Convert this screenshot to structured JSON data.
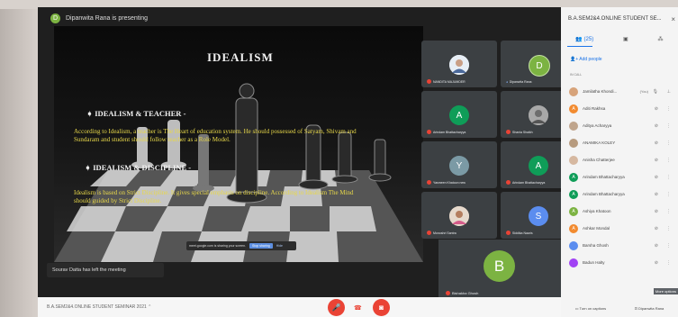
{
  "presenter_bar": {
    "initial": "D",
    "text": "Dipanwita Rana is presenting"
  },
  "slide": {
    "title": "IDEALISM",
    "heading1": "IDEALISM & TEACHER -",
    "paragraph1": "According to Idealism, a teacher is The Heart of education system. He should possessed of Satyam, Shivam and Sundaram and student should follow teacher as a Role Model.",
    "heading2": "IDEALISM & DISCIPLINE -",
    "paragraph2": "Idealism is based on Strict Discipline. It gives special emphasis on discipline. According to Idealism The Mind should guided by Strict Discipline."
  },
  "share_bar": {
    "text": "meet.google.com is sharing your screen.",
    "stop_label": "Stop sharing",
    "hide_label": "Hide"
  },
  "notification": "Sourav Datta has left the meeting",
  "tiles": [
    {
      "name": "NANDITA MAJUMDER",
      "initial": "",
      "color": "#dfe7ef",
      "photo": true
    },
    {
      "name": "Dipanwita Rana",
      "initial": "D",
      "color": "#7cb342",
      "photo": false
    },
    {
      "name": "Arindam Bhattacharyya",
      "initial": "A",
      "color": "#0f9d58",
      "photo": false
    },
    {
      "name": "Shania Shaikh",
      "initial": "",
      "color": "#999999",
      "photo": true
    },
    {
      "name": "Yasmeen Khatoon new",
      "initial": "Y",
      "color": "#7b9aa5",
      "photo": false
    },
    {
      "name": "Arindam Bhattacharyya",
      "initial": "A",
      "color": "#0f9d58",
      "photo": false
    },
    {
      "name": "Monoshri Santra",
      "initial": "",
      "color": "#c9b39e",
      "photo": true
    },
    {
      "name": "Siddika Naaris",
      "initial": "S",
      "color": "#5b8def",
      "photo": false
    }
  ],
  "big_tile": {
    "name": "Bishakha Ghosh",
    "initial": "B"
  },
  "sidebar": {
    "title": "B.A.SEM2&4.ONLINE STUDENT SE...",
    "close": "×",
    "people_count": "(25)",
    "add_people": "Add people",
    "section": "IN CALL",
    "participants": [
      {
        "name": "Jamilatha Khondi...",
        "badge": "(You)",
        "color": "#d7a37a",
        "initial": ""
      },
      {
        "name": "Aditi Rakhsa",
        "badge": "",
        "color": "#f28b30",
        "initial": "A"
      },
      {
        "name": "Aditya Acharyya",
        "badge": "",
        "color": "#c0a58c",
        "initial": ""
      },
      {
        "name": "ANAMIKA KOLEY",
        "badge": "",
        "color": "#b79b7e",
        "initial": ""
      },
      {
        "name": "Anisha Chatterjee",
        "badge": "",
        "color": "#d6b8a0",
        "initial": ""
      },
      {
        "name": "Arindam Bhattacharyya",
        "badge": "",
        "color": "#0f9d58",
        "initial": "A"
      },
      {
        "name": "Arindam Bhattacharyya",
        "badge": "",
        "color": "#0f9d58",
        "initial": "A"
      },
      {
        "name": "Ashiya Khatoon",
        "badge": "",
        "color": "#7cb342",
        "initial": "A"
      },
      {
        "name": "Ashkar Mondal",
        "badge": "",
        "color": "#f28b30",
        "initial": "A"
      },
      {
        "name": "Barsha Ghosh",
        "badge": "",
        "color": "#5b8def",
        "initial": ""
      },
      {
        "name": "Badun Halty",
        "badge": "",
        "color": "#a142f4",
        "initial": ""
      }
    ],
    "tooltip": "More options",
    "footer_left": "Turn on captions",
    "footer_right": "Dipanwita Rana"
  },
  "bottom_bar": {
    "meeting_title": "B.A.SEM2&4.ONLINE STUDENT SEMINAR 2021"
  }
}
